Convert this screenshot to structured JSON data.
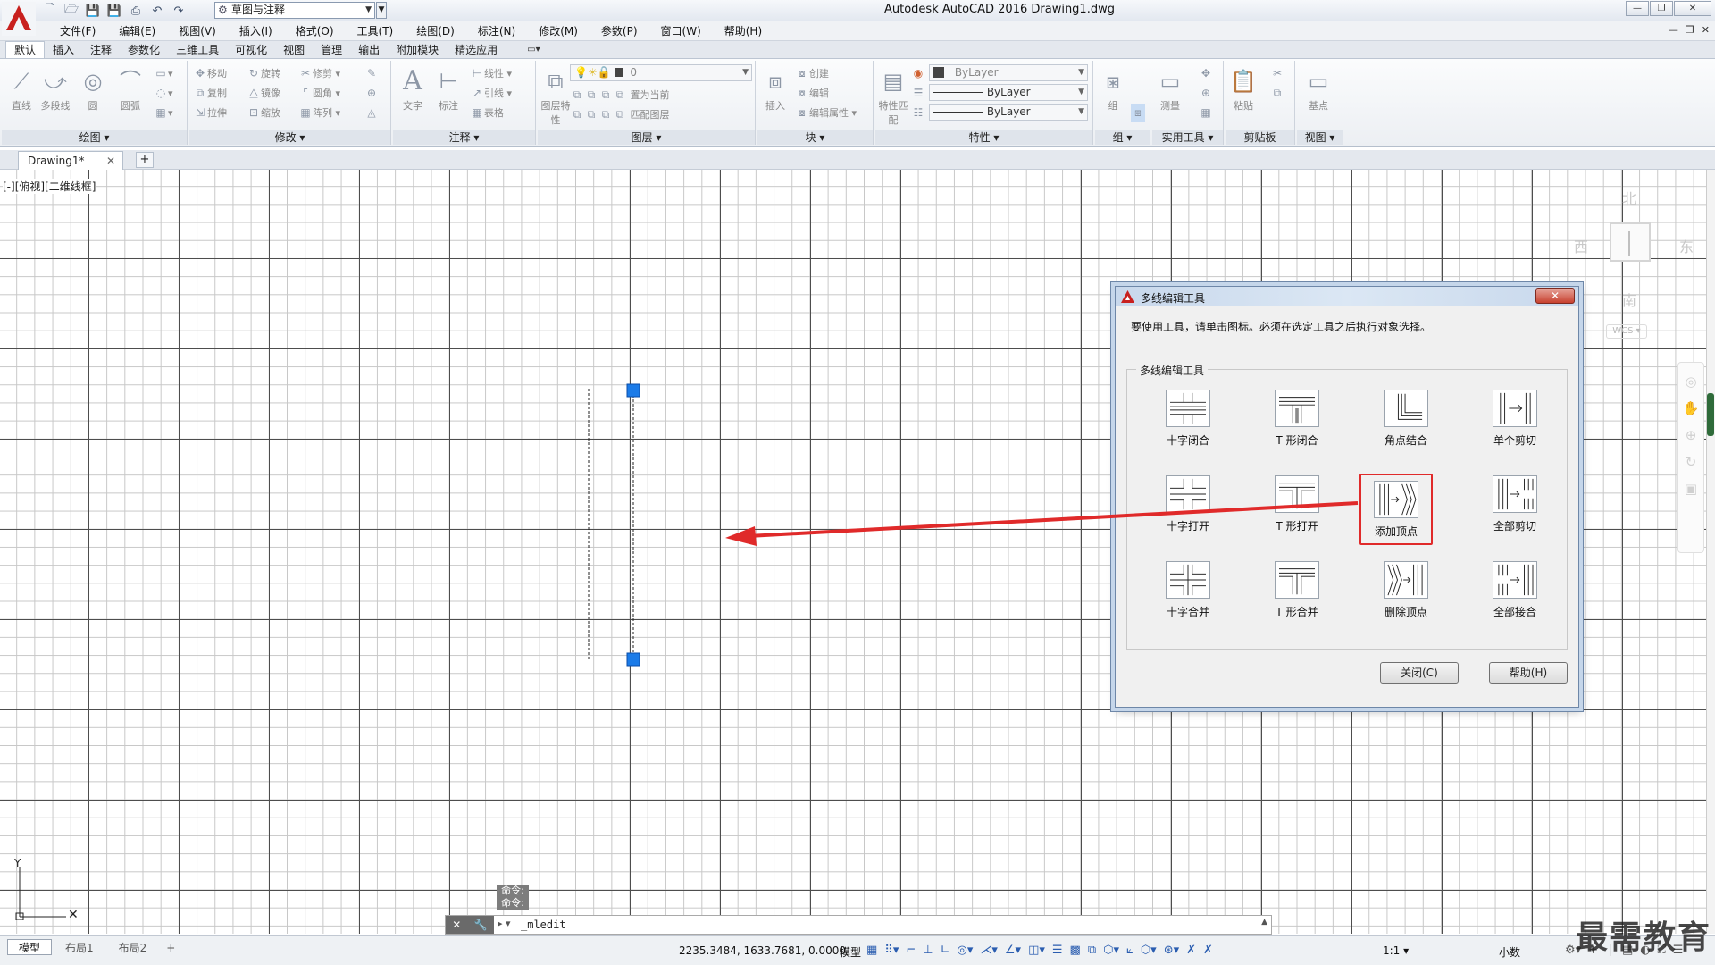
{
  "window": {
    "title": "Autodesk AutoCAD 2016    Drawing1.dwg",
    "controls": [
      "—",
      "❐",
      "✕"
    ]
  },
  "qat": {
    "workspace": "草图与注释"
  },
  "menu": {
    "items": [
      "文件(F)",
      "编辑(E)",
      "视图(V)",
      "插入(I)",
      "格式(O)",
      "工具(T)",
      "绘图(D)",
      "标注(N)",
      "修改(M)",
      "参数(P)",
      "窗口(W)",
      "帮助(H)"
    ],
    "doc_controls": [
      "—",
      "❐",
      "✕"
    ]
  },
  "ribbon_tabs": [
    "默认",
    "插入",
    "注释",
    "参数化",
    "三维工具",
    "可视化",
    "视图",
    "管理",
    "输出",
    "附加模块",
    "精选应用"
  ],
  "ribbon": {
    "draw": {
      "title": "绘图",
      "line": "直线",
      "polyline": "多段线",
      "circle": "圆",
      "arc": "圆弧"
    },
    "modify": {
      "title": "修改",
      "move": "移动",
      "rotate": "旋转",
      "trim": "修剪",
      "copy": "复制",
      "mirror": "镜像",
      "fillet": "圆角",
      "stretch": "拉伸",
      "scale": "缩放",
      "array": "阵列"
    },
    "annotation": {
      "title": "注释",
      "text": "文字",
      "dimension": "标注",
      "linear": "线性",
      "leader": "引线",
      "table": "表格"
    },
    "layers": {
      "title": "图层",
      "layer_props": "图层特性",
      "layer_value": "0",
      "set_current": "置为当前",
      "match_layer": "匹配图层"
    },
    "block": {
      "title": "块",
      "insert": "插入",
      "create": "创建",
      "edit": "编辑",
      "edit_attr": "编辑属性"
    },
    "properties": {
      "title": "特性",
      "match": "特性匹配",
      "color": "ByLayer",
      "linetype": "ByLayer",
      "lineweight": "ByLayer"
    },
    "groups": {
      "title": "组",
      "group": "组"
    },
    "utilities": {
      "title": "实用工具",
      "measure": "测量"
    },
    "clipboard": {
      "title": "剪贴板",
      "paste": "粘贴"
    },
    "view": {
      "title": "视图",
      "base": "基点"
    }
  },
  "file_tabs": {
    "current": "Drawing1*"
  },
  "viewport": {
    "label": "[-][俯视][二维线框]",
    "viewcube": {
      "north": "北",
      "south": "南",
      "east": "东",
      "west": "西",
      "wcs": "WCS"
    }
  },
  "dialog": {
    "title": "多线编辑工具",
    "instruction": "要使用工具，请单击图标。必须在选定工具之后执行对象选择。",
    "group_label": "多线编辑工具",
    "tools": [
      [
        "十字闭合",
        "T 形闭合",
        "角点结合",
        "单个剪切"
      ],
      [
        "十字打开",
        "T 形打开",
        "添加顶点",
        "全部剪切"
      ],
      [
        "十字合并",
        "T 形合并",
        "删除顶点",
        "全部接合"
      ]
    ],
    "highlighted_tool": "添加顶点",
    "close_button": "关闭(C)",
    "help_button": "帮助(H)"
  },
  "command": {
    "history": [
      "命令:",
      "命令:"
    ],
    "prompt": "▸ ▾",
    "input_value": "_mledit"
  },
  "status": {
    "layout_tabs": [
      "模型",
      "布局1",
      "布局2",
      "+"
    ],
    "coordinates": "2235.3484, 1633.7681, 0.0000",
    "model": "模型",
    "scale": "1:1 ▾",
    "units": "小数"
  },
  "watermark": "最需教育",
  "colors": {
    "highlight": "#e02a2a",
    "grip": "#1b7be8",
    "arrow": "#e02a2a"
  }
}
